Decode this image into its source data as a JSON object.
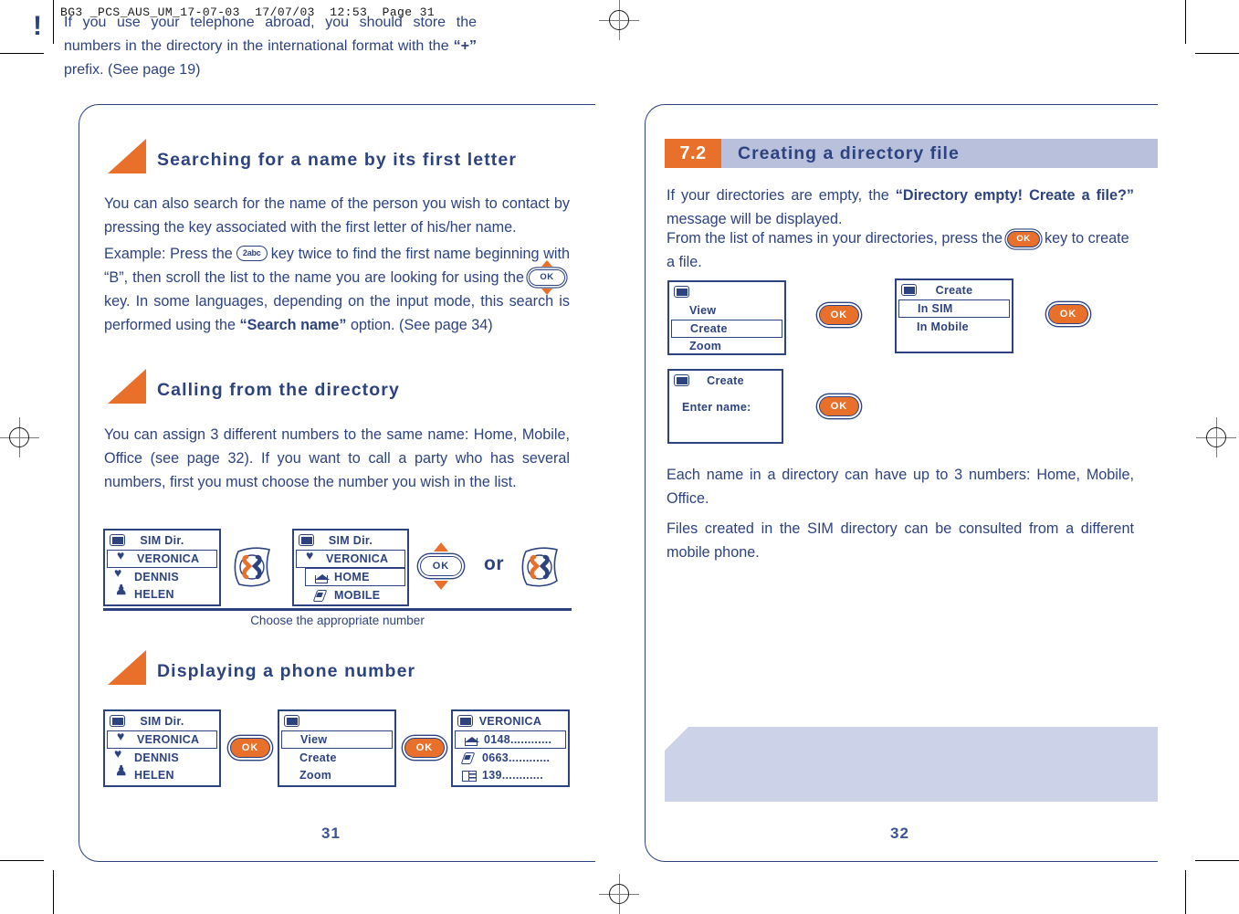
{
  "prepress": {
    "slug": "BG3 _PCS_AUS_UM_17-07-03  17/07/03  12:53  Page 31"
  },
  "colors": {
    "brand_blue": "#2d4380",
    "accent_orange": "#e8702a",
    "header_band": "#b9c0dc",
    "warn_bg": "#ccd3e8"
  },
  "left_page": {
    "folio": "31",
    "sections": [
      {
        "title": "Searching for a name by its first letter"
      },
      {
        "title": "Calling from the directory"
      },
      {
        "title": "Displaying a phone number"
      }
    ],
    "para1": "You can also search for the name of the person you wish to contact by pressing the key associated with the first letter of his/her name.",
    "para2_a": "Example: Press the",
    "key_2abc": "2abc",
    "para2_b": "key twice to find the first name beginning with “B”, then scroll the list to the name you are looking for using the",
    "key_ok": "OK",
    "para2_c": "key. In some languages, depending on the input mode, this search is performed using the",
    "para2_bold": "“Search name”",
    "para2_d": "option. (See page 34)",
    "para3": "You can assign 3 different numbers to the same name: Home, Mobile, Office (see page 32). If you want to call a party who has several numbers, first you must choose the number you wish in the list.",
    "caption": "Choose the appropriate number",
    "diagram_calling": {
      "screen1": {
        "title": "SIM Dir.",
        "rows": [
          {
            "icon": "heart-icon",
            "label": "VERONICA",
            "selected": true
          },
          {
            "icon": "heart-icon",
            "label": "DENNIS",
            "selected": false
          },
          {
            "icon": "people-icon",
            "label": "HELEN",
            "selected": false
          }
        ]
      },
      "call_key_1": "call-key",
      "screen2": {
        "title": "SIM Dir.",
        "rows": [
          {
            "icon": "heart-icon",
            "label": "VERONICA",
            "selected": true
          },
          {
            "icon": "home-icon",
            "label": "HOME",
            "selected": true
          },
          {
            "icon": "mobile-icon",
            "label": "MOBILE",
            "selected": false
          }
        ]
      },
      "nav_ok": "OK",
      "or": "or",
      "call_key_2": "call-key"
    },
    "diagram_display": {
      "screen1": {
        "title": "SIM Dir.",
        "rows": [
          {
            "icon": "heart-icon",
            "label": "VERONICA",
            "selected": true
          },
          {
            "icon": "heart-icon",
            "label": "DENNIS",
            "selected": false
          },
          {
            "icon": "people-icon",
            "label": "HELEN",
            "selected": false
          }
        ]
      },
      "ok1": "OK",
      "screen2": {
        "title": "",
        "rows": [
          {
            "icon": "",
            "label": "View",
            "selected": true
          },
          {
            "icon": "",
            "label": "Create",
            "selected": false
          },
          {
            "icon": "",
            "label": "Zoom",
            "selected": false
          }
        ]
      },
      "ok2": "OK",
      "screen3": {
        "title": "VERONICA",
        "rows": [
          {
            "icon": "home-icon",
            "label": "0148............",
            "selected": true
          },
          {
            "icon": "mobile-icon",
            "label": "0663............",
            "selected": false
          },
          {
            "icon": "office-icon",
            "label": "139............",
            "selected": false
          }
        ]
      }
    }
  },
  "right_page": {
    "folio": "32",
    "chapter": {
      "number": "7.2",
      "title": "Creating a directory file"
    },
    "para1_a": "If your directories are empty, the",
    "para1_bold": "“Directory empty! Create a file?”",
    "para1_b": "message will be displayed.",
    "para1_c": "From the list of names in your directories, press the",
    "key_ok": "OK",
    "para1_d": "key to create a file.",
    "para2": "Each name in a directory can have up to 3 numbers: Home, Mobile, Office.",
    "para3": "Files created in the SIM directory can be consulted from a different mobile phone.",
    "diagram_create": {
      "screen1": {
        "title": "",
        "rows": [
          {
            "label": "View",
            "selected": false
          },
          {
            "label": "Create",
            "selected": true
          },
          {
            "label": "Zoom",
            "selected": false
          }
        ]
      },
      "ok1": "OK",
      "screen2": {
        "title": "Create",
        "rows": [
          {
            "label": "In SIM",
            "selected": true
          },
          {
            "label": "In Mobile",
            "selected": false
          }
        ]
      },
      "ok2": "OK",
      "screen3": {
        "title": "Create",
        "rows": [
          {
            "label": "Enter name:",
            "selected": false
          }
        ]
      },
      "ok3": "OK"
    },
    "warning": {
      "icon": "exclamation-icon",
      "text_a": "If you use your telephone abroad, you should store the numbers in the directory in the international format with the",
      "text_bold": "“+”",
      "text_b": "prefix. (See page 19)"
    }
  }
}
